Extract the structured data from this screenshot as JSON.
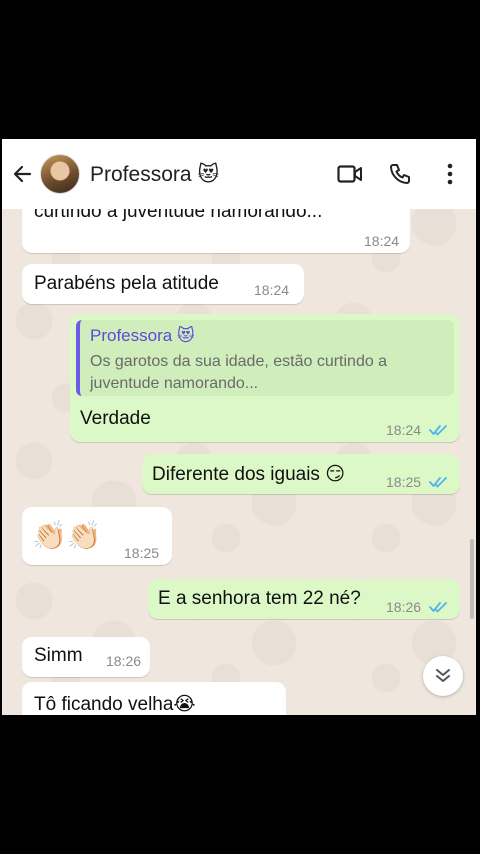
{
  "header": {
    "contact_name": "Professora 😻",
    "icons": [
      "back-arrow-icon",
      "avatar",
      "video-call-icon",
      "voice-call-icon",
      "more-options-icon"
    ]
  },
  "messages": [
    {
      "direction": "in",
      "text": "curtindo a juventude namorando...",
      "time": "18:24"
    },
    {
      "direction": "in",
      "text": "Parabéns pela atitude",
      "time": "18:24"
    },
    {
      "direction": "out",
      "quote_name": "Professora 😻",
      "quote_text": "Os garotos da sua idade, estão curtindo a juventude namorando...",
      "text": "Verdade",
      "time": "18:24",
      "status": "read"
    },
    {
      "direction": "out",
      "text": "Diferente dos iguais 😏",
      "time": "18:25",
      "status": "read"
    },
    {
      "direction": "in",
      "text": "👏🏻👏🏻",
      "time": "18:25"
    },
    {
      "direction": "out",
      "text": "E a senhora tem 22 né?",
      "time": "18:26",
      "status": "read"
    },
    {
      "direction": "in",
      "text": "Simm",
      "time": "18:26"
    },
    {
      "direction": "in",
      "text": "Tô ficando velha😭",
      "time": ""
    }
  ],
  "colors": {
    "incoming": "#ffffff",
    "outgoing": "#dcf8c6",
    "read_ticks": "#4fb6ec",
    "quote_bar": "#6c5ce7"
  }
}
